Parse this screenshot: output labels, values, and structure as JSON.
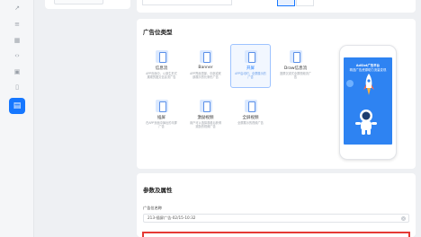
{
  "rail": {
    "icons": [
      "link-icon",
      "list-icon",
      "grid-icon",
      "code-icon",
      "image-icon",
      "document-icon",
      "report-icon"
    ]
  },
  "ad_types": {
    "title": "广告位类型",
    "tiles": [
      {
        "name": "信息流",
        "desc": "APP页面中，以原生形式展现的图文信息流广告",
        "icon": "feed-icon",
        "active": false
      },
      {
        "name": "Banner",
        "desc": "APP界面顶部、中部或底部展示的长条形广告",
        "icon": "banner-icon",
        "active": false
      },
      {
        "name": "开屏",
        "desc": "APP启动时，全屏展示的广告",
        "icon": "splash-icon",
        "active": true
      },
      {
        "name": "Draw信息流",
        "desc": "竖屏沉浸式全屏视频流广告",
        "icon": "draw-feed-icon",
        "active": false
      },
      {
        "name": "插屏",
        "desc": "在APP页面中弹出的半屏广告",
        "icon": "interstitial-icon",
        "active": false
      },
      {
        "name": "激励视频",
        "desc": "用户可以选择观看后获得奖励的视频广告",
        "icon": "reward-video-icon",
        "active": false
      },
      {
        "name": "全屏视频",
        "desc": "全屏展示的视频广告",
        "icon": "fullscreen-video-icon",
        "active": false
      }
    ],
    "preview": {
      "line1": "AdSlot广告平台",
      "line2": "精选广告资源助力流量变现"
    }
  },
  "params": {
    "title": "参数及属性",
    "name_label": "广告位名称",
    "name_value": "213-插屏广告-02/15-10:32"
  },
  "colors": {
    "accent": "#1677ff",
    "highlight_border": "#e53935"
  }
}
